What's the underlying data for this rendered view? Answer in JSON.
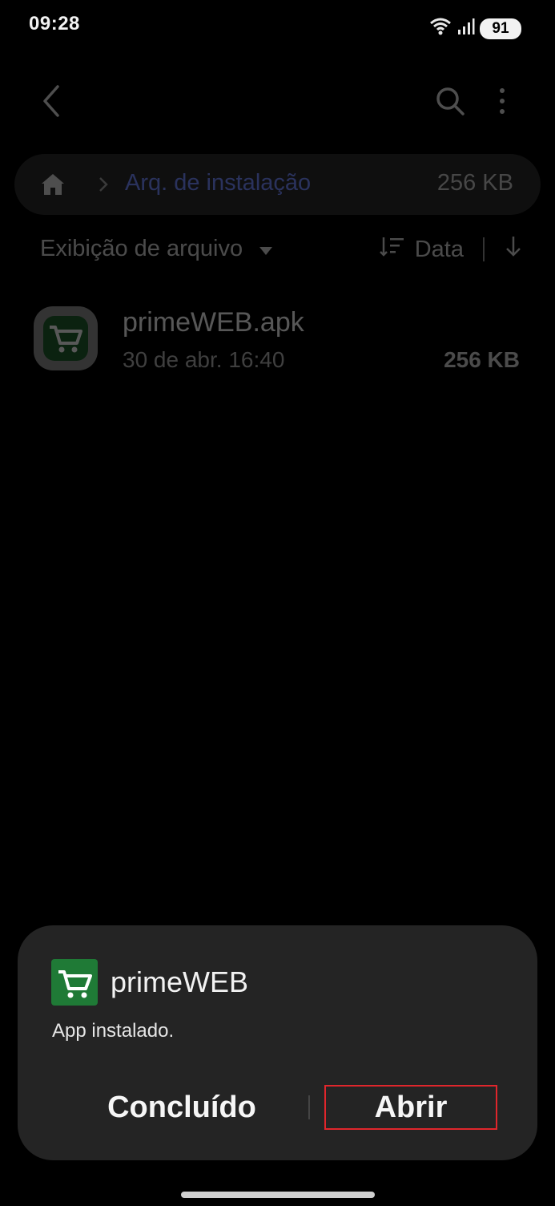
{
  "status_bar": {
    "time": "09:28",
    "battery": "91",
    "icons": [
      "wifi-icon",
      "signal-icon",
      "battery-icon"
    ]
  },
  "toolbar": {
    "icons": [
      "back-icon",
      "search-icon",
      "more-options-icon"
    ]
  },
  "breadcrumb": {
    "path": "Arq. de instalação",
    "size": "256 KB",
    "path_color": "#6f86f6"
  },
  "sort_bar": {
    "view_label": "Exibição de arquivo",
    "sort_label": "Data"
  },
  "file_list": [
    {
      "name": "primeWEB.apk",
      "date": "30 de abr. 16:40",
      "size": "256 KB",
      "icon": "cart-icon"
    }
  ],
  "dialog": {
    "app_name": "primeWEB",
    "status": "App instalado.",
    "done_label": "Concluído",
    "open_label": "Abrir",
    "app_icon_color": "#1f7a36",
    "highlight_color": "#e0262c"
  }
}
